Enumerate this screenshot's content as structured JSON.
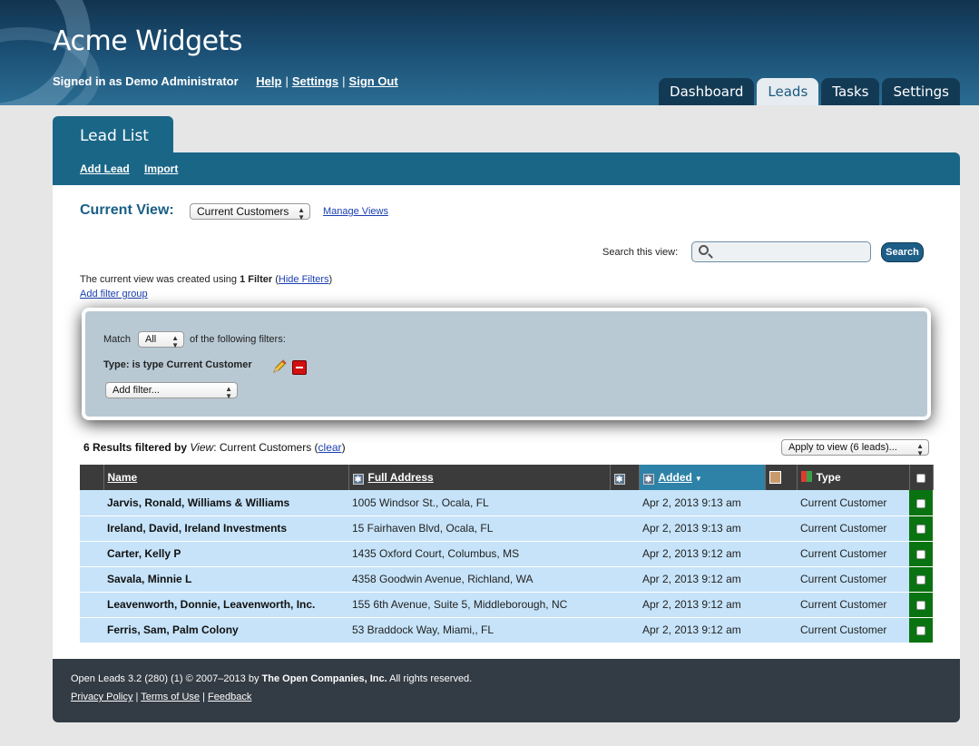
{
  "app": {
    "title": "Acme Widgets",
    "signed_in": "Signed in as Demo Administrator",
    "links": [
      "Help",
      "Settings",
      "Sign Out"
    ]
  },
  "main_tabs": [
    "Dashboard",
    "Leads",
    "Tasks",
    "Settings"
  ],
  "active_tab": "Leads",
  "section": {
    "tab": "Lead List",
    "actions": [
      "Add Lead",
      "Import"
    ]
  },
  "view": {
    "label": "Current View:",
    "selected": "Current Customers",
    "manage_link": "Manage Views"
  },
  "search": {
    "label": "Search this view:",
    "placeholder": "",
    "button": "Search"
  },
  "filter_info": {
    "prefix": "The current view was created using",
    "count": "1 Filter",
    "hide_link": "Hide Filters",
    "add_group": "Add filter group"
  },
  "filters": {
    "match_label": "Match",
    "match_value": "All",
    "match_suffix": "of the following filters:",
    "rule": "Type: is type Current Customer",
    "add_filter": "Add filter..."
  },
  "results": {
    "count_text": "6 Results filtered by",
    "view_word": "View",
    "view_name": ": Current Customers (",
    "clear": "clear",
    "close": ")",
    "apply_select": "Apply to view (6 leads)..."
  },
  "table": {
    "headers": {
      "name": "Name",
      "address": "Full Address",
      "added": "Added",
      "type": "Type"
    },
    "rows": [
      {
        "name": "Jarvis, Ronald, Williams & Williams",
        "address": "1005 Windsor St., Ocala, FL",
        "added": "Apr 2, 2013 9:13 am",
        "type": "Current Customer"
      },
      {
        "name": "Ireland, David, Ireland Investments",
        "address": "15 Fairhaven Blvd, Ocala, FL",
        "added": "Apr 2, 2013 9:13 am",
        "type": "Current Customer"
      },
      {
        "name": "Carter, Kelly P",
        "address": "1435 Oxford Court, Columbus, MS",
        "added": "Apr 2, 2013 9:12 am",
        "type": "Current Customer"
      },
      {
        "name": "Savala, Minnie L",
        "address": "4358 Goodwin Avenue, Richland, WA",
        "added": "Apr 2, 2013 9:12 am",
        "type": "Current Customer"
      },
      {
        "name": "Leavenworth, Donnie, Leavenworth, Inc.",
        "address": "155 6th Avenue, Suite 5, Middleborough, NC",
        "added": "Apr 2, 2013 9:12 am",
        "type": "Current Customer"
      },
      {
        "name": "Ferris, Sam, Palm Colony",
        "address": "53 Braddock Way, Miami,, FL",
        "added": "Apr 2, 2013 9:12 am",
        "type": "Current Customer"
      }
    ]
  },
  "footer": {
    "line1_prefix": "Open Leads 3.2 (280) (1) © 2007–2013 by",
    "company": "The Open Companies, Inc.",
    "line1_suffix": "All rights reserved.",
    "links": [
      "Privacy Policy",
      "Terms of Use",
      "Feedback"
    ]
  },
  "colors": {
    "header": "#1a4d72",
    "accent": "#1a6687",
    "row_bg": "#c6e3f9",
    "checkbox_col": "#0a7311"
  }
}
